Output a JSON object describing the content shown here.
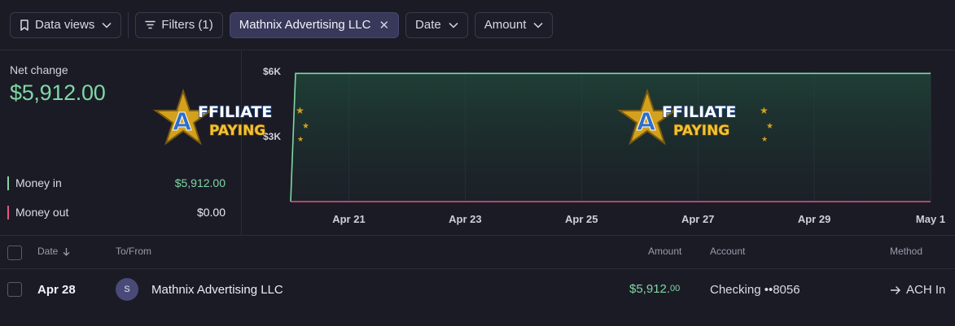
{
  "toolbar": {
    "data_views": "Data views",
    "filters": "Filters (1)",
    "active_filter": "Mathnix Advertising LLC",
    "date": "Date",
    "amount": "Amount"
  },
  "summary": {
    "net_label": "Net change",
    "net_value": "$5,912.00",
    "money_in_label": "Money in",
    "money_in_value": "$5,912.00",
    "money_out_label": "Money out",
    "money_out_value": "$0.00"
  },
  "colors": {
    "money_in": "#7fd7a4",
    "money_out": "#e4577c",
    "accent_pill": "#38385a"
  },
  "chart_data": {
    "type": "area",
    "x": [
      "Apr 20",
      "Apr 20",
      "May 1"
    ],
    "series": [
      {
        "name": "Money in",
        "values": [
          0,
          5912,
          5912
        ]
      },
      {
        "name": "Money out",
        "values": [
          0,
          0,
          0
        ]
      }
    ],
    "x_ticks": [
      "Apr 21",
      "Apr 23",
      "Apr 25",
      "Apr 27",
      "Apr 29",
      "May 1"
    ],
    "y_ticks": [
      "$6K",
      "$3K"
    ],
    "ylim": [
      0,
      6000
    ],
    "grid": true
  },
  "watermark": {
    "line1": "FFILIATE",
    "line2": "PAYING",
    "mark": "A"
  },
  "table": {
    "headers": {
      "date": "Date",
      "to_from": "To/From",
      "amount": "Amount",
      "account": "Account",
      "method": "Method"
    },
    "rows": [
      {
        "date": "Apr 28",
        "avatar": "S",
        "name": "Mathnix Advertising LLC",
        "amount_main": "$5,912.",
        "amount_cents": "00",
        "account": "Checking ••8056",
        "method": "ACH In"
      }
    ]
  }
}
